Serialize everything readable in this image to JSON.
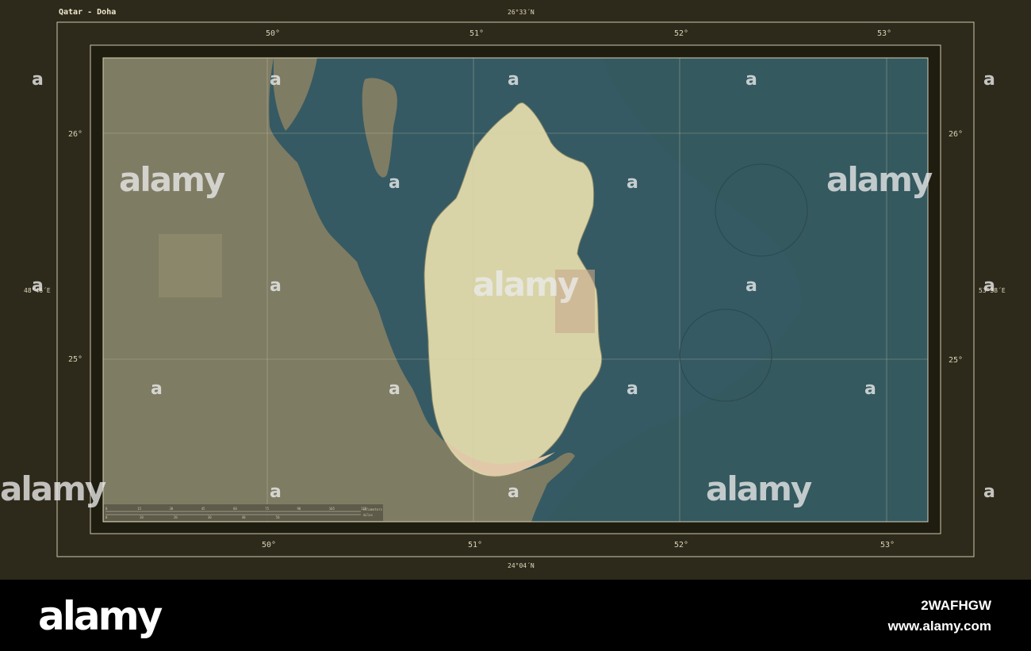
{
  "title": "Qatar - Doha",
  "frame": {
    "top_latitude": "26°33´N",
    "bottom_latitude": "24°04´N",
    "left_longitude": "48°46´E",
    "right_longitude": "53°38´E"
  },
  "graticule": {
    "longitudes": [
      "50°",
      "51°",
      "52°",
      "53°"
    ],
    "latitudes": [
      "26°",
      "25°"
    ]
  },
  "scale_bar": {
    "km_label": "kilometers",
    "mi_label": "miles",
    "km_ticks": [
      "0",
      "15",
      "30",
      "45",
      "60",
      "75",
      "90",
      "105",
      "120"
    ],
    "mi_ticks": [
      "0",
      "10",
      "20",
      "30",
      "40",
      "50"
    ]
  },
  "colors": {
    "sea": "#355a63",
    "sea_deep": "#2f4f57",
    "land_other": "#7f7c64",
    "highlight_land": "#d8d4a7",
    "frame_bg": "#2e2a1b",
    "inner_frame": "#1f1c10"
  },
  "watermark": {
    "text": "alamy",
    "small_mark": "a"
  },
  "footer": {
    "logo": "alamy",
    "image_id": "2WAFHGW",
    "url": "www.alamy.com"
  }
}
